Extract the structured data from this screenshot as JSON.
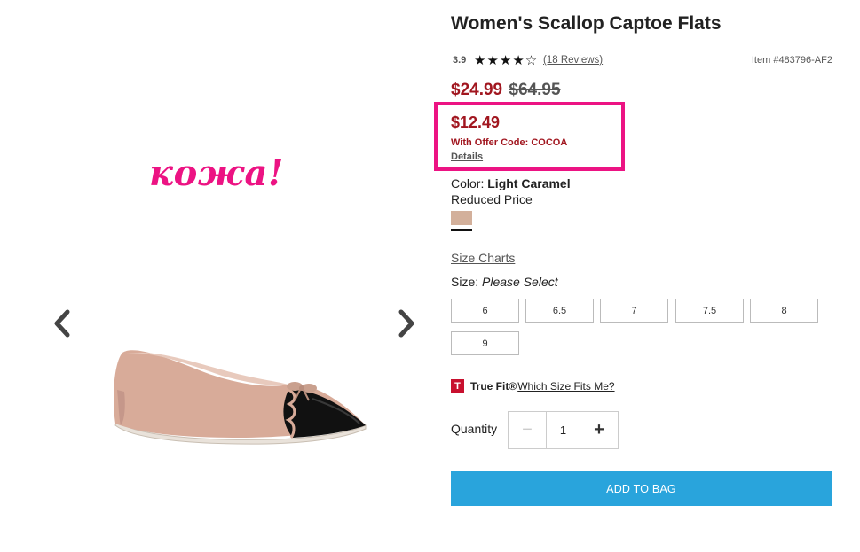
{
  "gallery": {
    "annotation": "кожа!",
    "prev_icon": "chevron-left-icon",
    "next_icon": "chevron-right-icon",
    "image": "shoe-photo"
  },
  "product": {
    "title": "Women's Scallop Captoe Flats",
    "rating": "3.9",
    "stars_filled": 4,
    "stars_total": 5,
    "stars_display": "★★★★",
    "star_empty": "☆",
    "reviews": "(18 Reviews)",
    "item_number": "Item #483796-AF2",
    "sale_price": "$24.99",
    "original_price": "$64.95"
  },
  "offer": {
    "price": "$12.49",
    "code_text": "With Offer Code: COCOA",
    "details": "Details",
    "highlight_color": "#ec1383"
  },
  "color": {
    "label": "Color:",
    "value": "Light Caramel",
    "note": "Reduced Price",
    "swatch_color": "#d3b09b"
  },
  "sizes": {
    "chart_link": "Size Charts",
    "label": "Size:",
    "prompt": "Please Select",
    "options": [
      "6",
      "6.5",
      "7",
      "7.5",
      "8",
      "9"
    ]
  },
  "truefit": {
    "logo": "T",
    "name": "True Fit®",
    "link": "Which Size Fits Me?"
  },
  "quantity": {
    "label": "Quantity",
    "minus": "−",
    "value": "1",
    "plus": "+"
  },
  "cta": {
    "add_to_bag": "ADD TO BAG",
    "color": "#29a4dc"
  },
  "colors": {
    "sale_red": "#a1161f",
    "annotation_pink": "#ec1383"
  }
}
